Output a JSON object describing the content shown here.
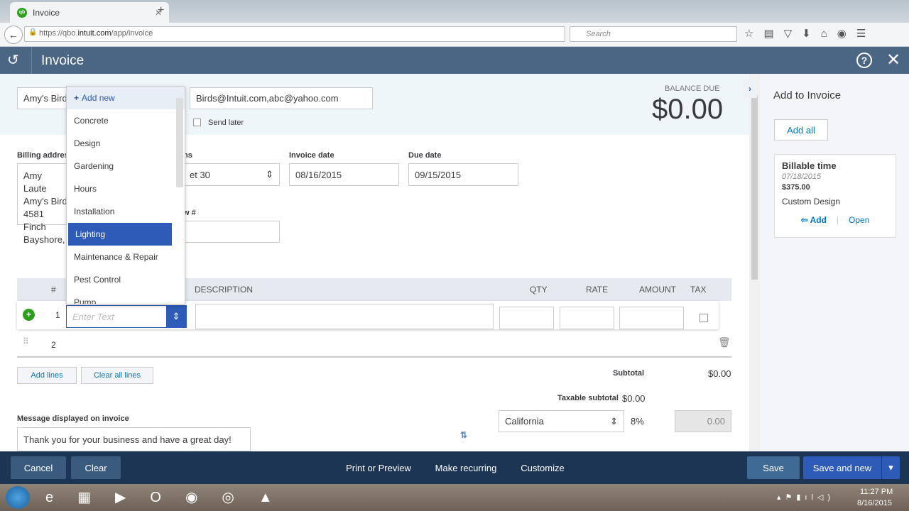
{
  "browser": {
    "tab_title": "Invoice",
    "url_prefix": "https://qbo.",
    "url_domain": "intuit.com",
    "url_path": "/app/invoice",
    "search_placeholder": "Search"
  },
  "header": {
    "title": "Invoice"
  },
  "customer": {
    "value": "Amy's Bird",
    "email": "Birds@Intuit.com,abc@yahoo.com",
    "send_later": "Send later"
  },
  "balance": {
    "label": "BALANCE DUE",
    "amount": "$0.00"
  },
  "billing": {
    "label": "Billing address",
    "lines": [
      "Amy Laute",
      "Amy's Bird",
      "4581 Finch",
      "Bayshore,"
    ]
  },
  "terms": {
    "label": "ns",
    "value": "et 30"
  },
  "invoice_date": {
    "label": "Invoice date",
    "value": "08/16/2015"
  },
  "due_date": {
    "label": "Due date",
    "value": "09/15/2015"
  },
  "po": {
    "label": "w #"
  },
  "dropdown": {
    "add_new": "Add new",
    "items": [
      "Concrete",
      "Design",
      "Gardening",
      "Hours",
      "Installation",
      "Lighting",
      "Maintenance & Repair",
      "Pest Control",
      "Pump"
    ],
    "selected": "Lighting"
  },
  "table": {
    "headers": {
      "num": "#",
      "description": "DESCRIPTION",
      "qty": "QTY",
      "rate": "RATE",
      "amount": "AMOUNT",
      "tax": "TAX"
    },
    "rows": [
      "1",
      "2"
    ],
    "product_placeholder": "Enter Text"
  },
  "actions": {
    "add_lines": "Add lines",
    "clear_lines": "Clear all lines"
  },
  "totals": {
    "subtotal_label": "Subtotal",
    "subtotal": "$0.00",
    "taxable_label": "Taxable subtotal",
    "taxable": "$0.00",
    "tax_rate": "California",
    "tax_pct": "8%",
    "tax_amount": "0.00"
  },
  "message": {
    "label": "Message displayed on invoice",
    "value": "Thank you for your business and have a great day!"
  },
  "sidebar": {
    "title": "Add to Invoice",
    "add_all": "Add all",
    "card": {
      "title": "Billable time",
      "date": "07/18/2015",
      "amount": "$375.00",
      "desc": "Custom Design",
      "add": "Add",
      "open": "Open"
    }
  },
  "footer": {
    "cancel": "Cancel",
    "clear": "Clear",
    "print": "Print or Preview",
    "recurring": "Make recurring",
    "customize": "Customize",
    "save": "Save",
    "save_new": "Save and new"
  },
  "taskbar": {
    "time": "11:27 PM",
    "date": "8/16/2015"
  },
  "colors": {
    "header": "#4b6584",
    "footer": "#1d3554",
    "accent": "#2e5bb8",
    "green": "#2ca01c"
  }
}
